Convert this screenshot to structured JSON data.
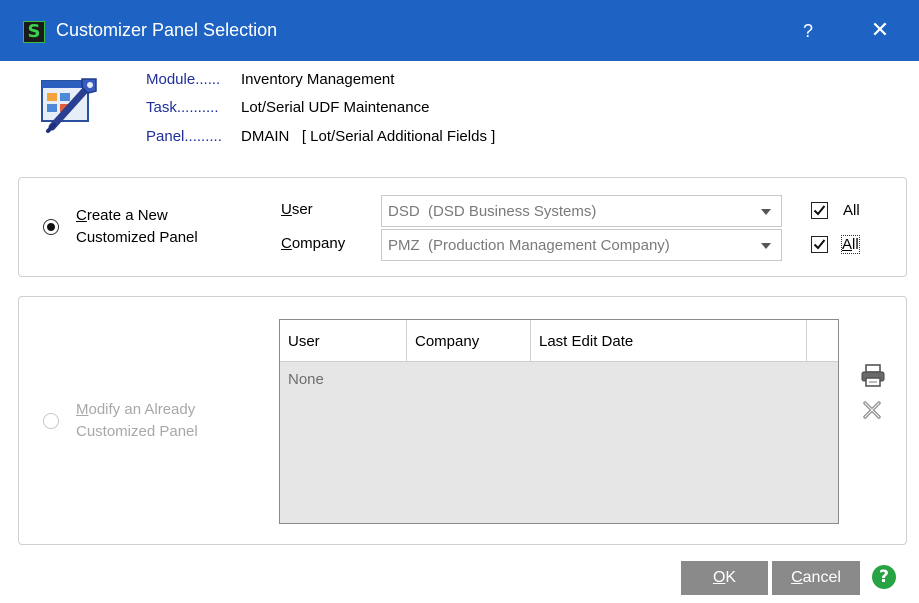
{
  "window": {
    "title": "Customizer Panel Selection",
    "app_icon_glyph": "S",
    "help_glyph": "?",
    "close_glyph": "✕"
  },
  "info": {
    "module_label": "Module......",
    "module_value": "Inventory Management",
    "task_label": "Task..........",
    "task_value": "Lot/Serial UDF Maintenance",
    "panel_label": "Panel.........",
    "panel_value": "DMAIN   [ Lot/Serial Additional Fields ]"
  },
  "create_section": {
    "radio_selected": true,
    "label_line1_underlined": "C",
    "label_line1_rest": "reate a New",
    "label_line2": "Customized Panel",
    "user_label_underlined": "U",
    "user_label_rest": "ser",
    "company_label_underlined": "C",
    "company_label_rest": "ompany",
    "user_value": "DSD  (DSD Business Systems)",
    "company_value": "PMZ  (Production Management Company)",
    "user_all_checked": true,
    "user_all_label": "All",
    "company_all_checked": true,
    "company_all_label_underlined": "A",
    "company_all_label_rest": "ll"
  },
  "modify_section": {
    "radio_selected": false,
    "label_line1_underlined": "M",
    "label_line1_rest": "odify an Already",
    "label_line2": "Customized Panel",
    "columns": [
      "User",
      "Company",
      "Last Edit Date"
    ],
    "empty_text": "None",
    "print_icon": "printer-icon",
    "delete_icon": "delete-x-icon"
  },
  "buttons": {
    "ok_underlined": "O",
    "ok_rest": "K",
    "cancel_underlined": "C",
    "cancel_rest": "ancel",
    "help_glyph": "?"
  },
  "colors": {
    "titlebar": "#1e63c3",
    "info_label": "#1f2e9a",
    "button_bg": "#8a8a8a",
    "help_green": "#27a344"
  }
}
